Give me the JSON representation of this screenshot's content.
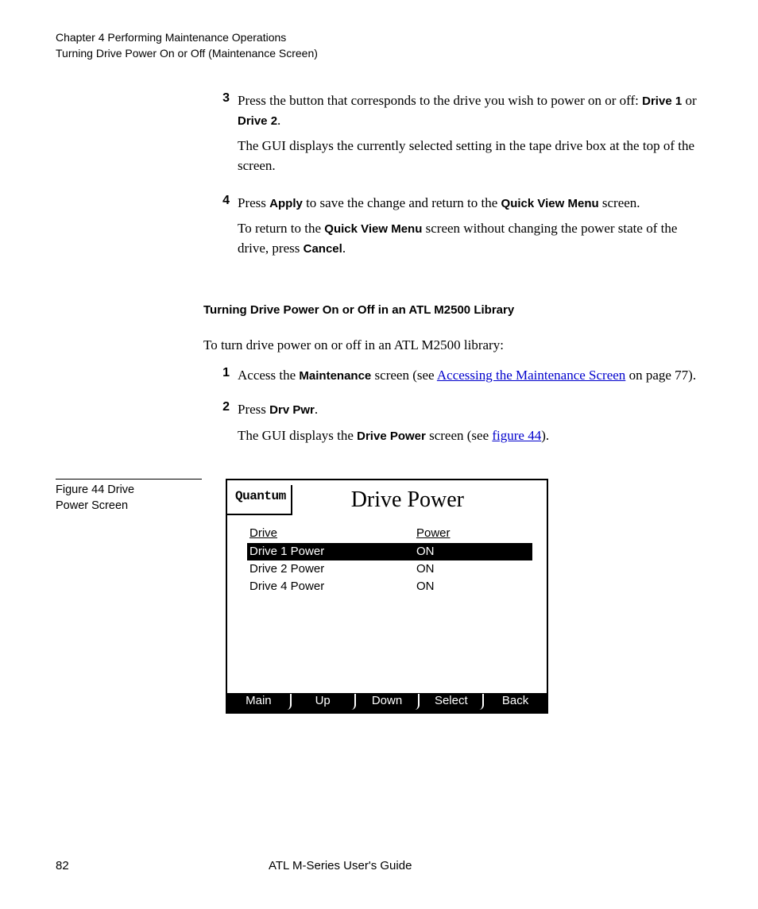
{
  "header": {
    "line1": "Chapter 4  Performing Maintenance Operations",
    "line2": "Turning Drive Power On or Off (Maintenance Screen)"
  },
  "steps_top": [
    {
      "num": "3",
      "pre": "Press the button that corresponds to the drive you wish to power on or off: ",
      "b1": "Drive 1",
      "mid": " or ",
      "b2": "Drive 2",
      "post": "."
    },
    {
      "num": "4",
      "pre": "Press ",
      "b1": "Apply",
      "mid": " to save the change and return to the ",
      "b2": "Quick View Menu",
      "post": " screen."
    }
  ],
  "para3a": "The GUI displays the currently selected setting in the tape drive box at the top of the screen.",
  "para4": {
    "pre": "To return to the ",
    "b1": "Quick View Menu",
    "mid": " screen without changing the power state of the drive, press ",
    "b2": "Cancel",
    "post": "."
  },
  "section_heading": "Turning Drive Power On or Off in an ATL M2500 Library",
  "intro": "To turn drive power on or off in an ATL M2500 library:",
  "steps_bottom": [
    {
      "num": "1",
      "pre": "Access the ",
      "b1": "Maintenance",
      "mid": " screen (see ",
      "link": "Accessing the Maintenance Screen",
      "post2": " on page 77)."
    },
    {
      "num": "2",
      "pre": "Press ",
      "b1": "Drv Pwr",
      "post": "."
    }
  ],
  "para_gui": {
    "pre": "The GUI displays the ",
    "b1": "Drive Power",
    "mid": " screen (see ",
    "link": "figure 44",
    "post": ")."
  },
  "figure_label": "Figure 44  Drive Power Screen",
  "gui": {
    "logo": "Quantum",
    "title": "Drive Power",
    "col1": "Drive",
    "col2": "Power",
    "rows": [
      {
        "drive": "Drive 1 Power",
        "power": "ON",
        "sel": true
      },
      {
        "drive": "Drive 2 Power",
        "power": "ON",
        "sel": false
      },
      {
        "drive": "Drive 4 Power",
        "power": "ON",
        "sel": false
      }
    ],
    "buttons": [
      "Main",
      "Up",
      "Down",
      "Select",
      "Back"
    ]
  },
  "footer": {
    "page": "82",
    "title": "ATL M-Series User's Guide"
  }
}
